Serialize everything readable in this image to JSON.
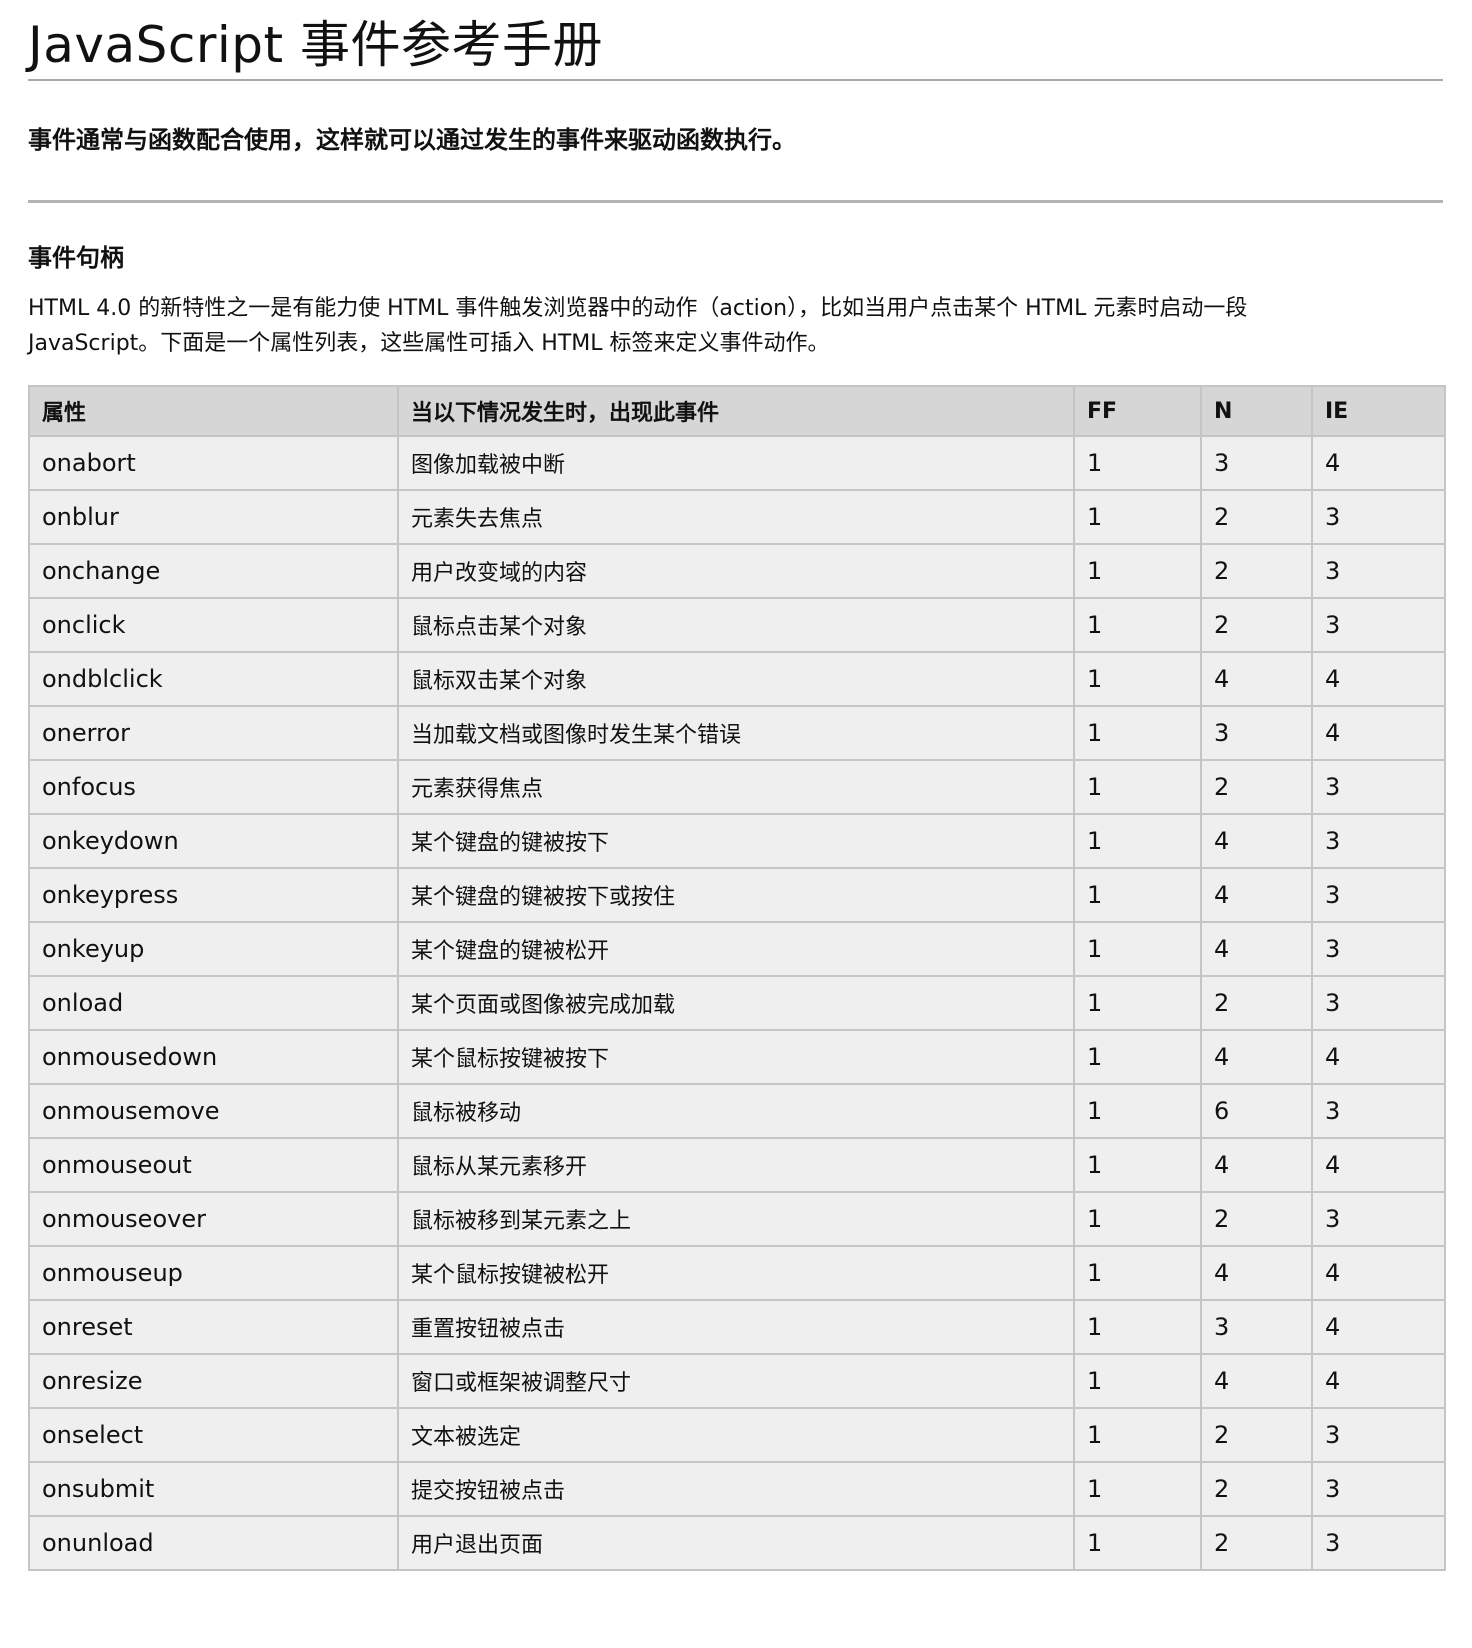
{
  "title": "JavaScript 事件参考手册",
  "intro": "事件通常与函数配合使用，这样就可以通过发生的事件来驱动函数执行。",
  "section": {
    "title": "事件句柄",
    "description_line1": "HTML 4.0 的新特性之一是有能力使 HTML 事件触发浏览器中的动作（action），比如当用户点击某个 HTML 元素时启动一段",
    "description_line2": "JavaScript。下面是一个属性列表，这些属性可插入 HTML 标签来定义事件动作。"
  },
  "table": {
    "headers": [
      "属性",
      "当以下情况发生时，出现此事件",
      "FF",
      "N",
      "IE"
    ],
    "rows": [
      [
        "onabort",
        "图像加载被中断",
        "1",
        "3",
        "4"
      ],
      [
        "onblur",
        "元素失去焦点",
        "1",
        "2",
        "3"
      ],
      [
        "onchange",
        "用户改变域的内容",
        "1",
        "2",
        "3"
      ],
      [
        "onclick",
        "鼠标点击某个对象",
        "1",
        "2",
        "3"
      ],
      [
        "ondblclick",
        "鼠标双击某个对象",
        "1",
        "4",
        "4"
      ],
      [
        "onerror",
        "当加载文档或图像时发生某个错误",
        "1",
        "3",
        "4"
      ],
      [
        "onfocus",
        "元素获得焦点",
        "1",
        "2",
        "3"
      ],
      [
        "onkeydown",
        "某个键盘的键被按下",
        "1",
        "4",
        "3"
      ],
      [
        "onkeypress",
        "某个键盘的键被按下或按住",
        "1",
        "4",
        "3"
      ],
      [
        "onkeyup",
        "某个键盘的键被松开",
        "1",
        "4",
        "3"
      ],
      [
        "onload",
        "某个页面或图像被完成加载",
        "1",
        "2",
        "3"
      ],
      [
        "onmousedown",
        "某个鼠标按键被按下",
        "1",
        "4",
        "4"
      ],
      [
        "onmousemove",
        "鼠标被移动",
        "1",
        "6",
        "3"
      ],
      [
        "onmouseout",
        "鼠标从某元素移开",
        "1",
        "4",
        "4"
      ],
      [
        "onmouseover",
        "鼠标被移到某元素之上",
        "1",
        "2",
        "3"
      ],
      [
        "onmouseup",
        "某个鼠标按键被松开",
        "1",
        "4",
        "4"
      ],
      [
        "onreset",
        "重置按钮被点击",
        "1",
        "3",
        "4"
      ],
      [
        "onresize",
        "窗口或框架被调整尺寸",
        "1",
        "4",
        "4"
      ],
      [
        "onselect",
        "文本被选定",
        "1",
        "2",
        "3"
      ],
      [
        "onsubmit",
        "提交按钮被点击",
        "1",
        "2",
        "3"
      ],
      [
        "onunload",
        "用户退出页面",
        "1",
        "2",
        "3"
      ]
    ]
  }
}
